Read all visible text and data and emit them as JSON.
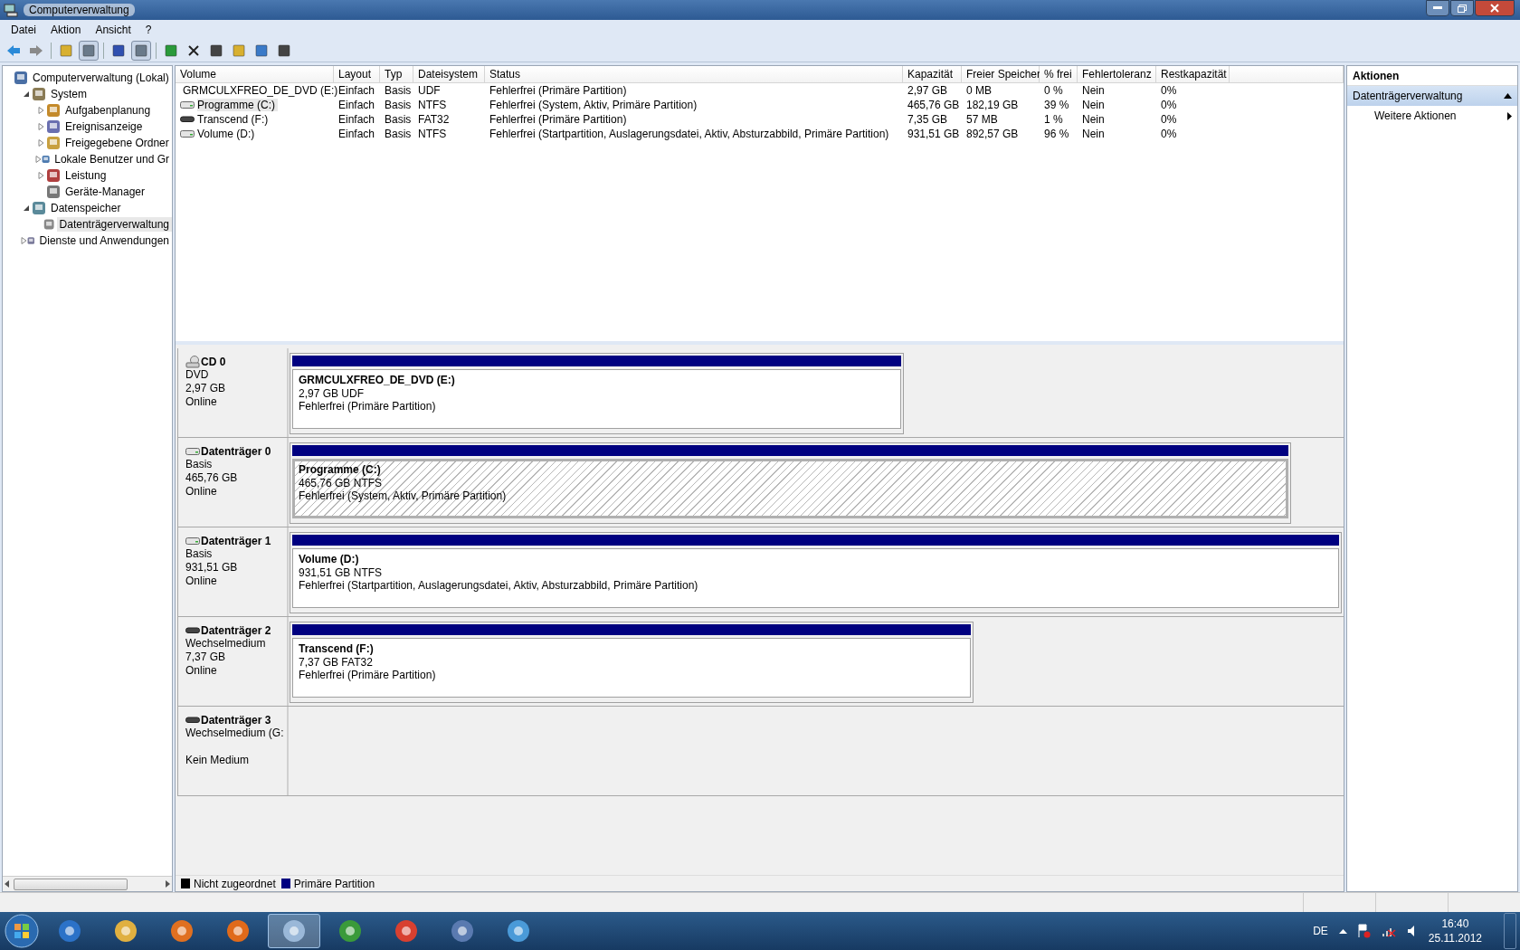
{
  "window": {
    "title": "Computerverwaltung"
  },
  "menu": [
    "Datei",
    "Aktion",
    "Ansicht",
    "?"
  ],
  "toolbar": [
    {
      "pressed": false
    },
    {
      "pressed": false
    },
    {
      "pressed": false
    },
    {
      "pressed": true
    },
    {
      "pressed": false
    },
    {
      "pressed": true
    },
    {
      "pressed": false
    },
    {
      "pressed": false
    },
    {
      "pressed": false
    },
    {
      "pressed": false
    },
    {
      "pressed": false
    },
    {
      "pressed": false
    }
  ],
  "tree": [
    {
      "label": "Computerverwaltung (Lokal)",
      "selected": false,
      "children": [
        {
          "label": "System",
          "expanded": true,
          "selected": false,
          "children": [
            {
              "label": "Aufgabenplanung",
              "expanded": false,
              "selected": false
            },
            {
              "label": "Ereignisanzeige",
              "expanded": false,
              "selected": false
            },
            {
              "label": "Freigegebene Ordner",
              "expanded": false,
              "selected": false
            },
            {
              "label": "Lokale Benutzer und Gr",
              "expanded": false,
              "selected": false
            },
            {
              "label": "Leistung",
              "expanded": false,
              "selected": false
            },
            {
              "label": "Geräte-Manager",
              "selected": false
            }
          ]
        },
        {
          "label": "Datenspeicher",
          "expanded": true,
          "selected": false,
          "children": [
            {
              "label": "Datenträgerverwaltung",
              "selected": true
            }
          ]
        },
        {
          "label": "Dienste und Anwendungen",
          "expanded": false,
          "selected": false
        }
      ]
    }
  ],
  "volume_table": {
    "columns": [
      "Volume",
      "Layout",
      "Typ",
      "Dateisystem",
      "Status",
      "Kapazität",
      "Freier Speicher",
      "% frei",
      "Fehlertoleranz",
      "Restkapazität"
    ],
    "rows": [
      {
        "kind": "cd",
        "selected": false,
        "cells": [
          "GRMCULXFREO_DE_DVD (E:)",
          "Einfach",
          "Basis",
          "UDF",
          "Fehlerfrei (Primäre Partition)",
          "2,97 GB",
          "0 MB",
          "0 %",
          "Nein",
          "0%"
        ]
      },
      {
        "kind": "disk",
        "selected": true,
        "cells": [
          "Programme (C:)",
          "Einfach",
          "Basis",
          "NTFS",
          "Fehlerfrei (System, Aktiv, Primäre Partition)",
          "465,76 GB",
          "182,19 GB",
          "39 %",
          "Nein",
          "0%"
        ]
      },
      {
        "kind": "removable",
        "selected": false,
        "cells": [
          "Transcend (F:)",
          "Einfach",
          "Basis",
          "FAT32",
          "Fehlerfrei (Primäre Partition)",
          "7,35 GB",
          "57 MB",
          "1 %",
          "Nein",
          "0%"
        ]
      },
      {
        "kind": "disk",
        "selected": false,
        "cells": [
          "Volume (D:)",
          "Einfach",
          "Basis",
          "NTFS",
          "Fehlerfrei (Startpartition, Auslagerungsdatei, Aktiv, Absturzabbild, Primäre Partition)",
          "931,51 GB",
          "892,57 GB",
          "96 %",
          "Nein",
          "0%"
        ]
      }
    ]
  },
  "disks": [
    {
      "kind": "cd",
      "name": "CD 0",
      "lines": [
        "DVD",
        "2,97 GB"
      ],
      "state": "Online",
      "partitions": [
        {
          "title": "GRMCULXFREO_DE_DVD  (E:)",
          "size": "2,97 GB UDF",
          "status": "Fehlerfrei (Primäre Partition)",
          "selected": false,
          "color": "#000080"
        }
      ]
    },
    {
      "kind": "disk",
      "name": "Datenträger 0",
      "lines": [
        "Basis",
        "465,76 GB"
      ],
      "state": "Online",
      "partitions": [
        {
          "title": "Programme  (C:)",
          "size": "465,76 GB NTFS",
          "status": "Fehlerfrei (System, Aktiv, Primäre Partition)",
          "selected": true,
          "color": "#000080"
        }
      ]
    },
    {
      "kind": "disk",
      "name": "Datenträger 1",
      "lines": [
        "Basis",
        "931,51 GB"
      ],
      "state": "Online",
      "partitions": [
        {
          "title": "Volume  (D:)",
          "size": "931,51 GB NTFS",
          "status": "Fehlerfrei (Startpartition, Auslagerungsdatei, Aktiv, Absturzabbild, Primäre Partition)",
          "selected": false,
          "color": "#000080"
        }
      ]
    },
    {
      "kind": "removable",
      "name": "Datenträger 2",
      "lines": [
        "Wechselmedium",
        "7,37 GB"
      ],
      "state": "Online",
      "partitions": [
        {
          "title": "Transcend  (F:)",
          "size": "7,37 GB FAT32",
          "status": "Fehlerfrei (Primäre Partition)",
          "selected": false,
          "color": "#000080"
        }
      ]
    },
    {
      "kind": "removable",
      "name": "Datenträger 3",
      "lines": [
        "Wechselmedium (G:"
      ],
      "state": "Kein Medium"
    }
  ],
  "legend": [
    {
      "label": "Nicht zugeordnet",
      "color": "#000000"
    },
    {
      "label": "Primäre Partition",
      "color": "#000080"
    }
  ],
  "actions": {
    "title": "Aktionen",
    "section": {
      "label": "Datenträgerverwaltung",
      "expanded": true
    },
    "items": [
      "Weitere Aktionen"
    ]
  },
  "taskbar": {
    "apps": [
      {
        "selected": false
      },
      {
        "selected": false
      },
      {
        "selected": false
      },
      {
        "selected": false
      },
      {
        "selected": true
      },
      {
        "selected": false
      },
      {
        "selected": false
      },
      {
        "selected": false
      },
      {
        "selected": false
      }
    ],
    "language": "DE",
    "time": "16:40",
    "date": "25.11.2012"
  }
}
